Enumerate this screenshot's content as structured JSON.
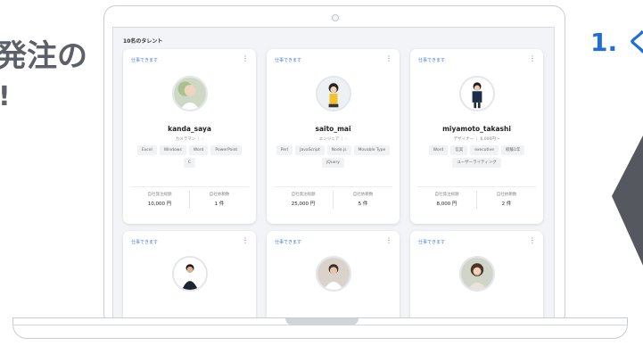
{
  "headline": {
    "line1": "発注の",
    "line2": "!"
  },
  "step_label": "1. く",
  "screen": {
    "header": "10名のタレント",
    "cards": [
      {
        "tag": "仕事できます",
        "name": "kanda_saya",
        "meta": "カメラマン ｜ -",
        "chips": [
          "Excel",
          "Windows",
          "Word",
          "PowerPoint",
          "C"
        ],
        "stat1_label": "自社発注総額",
        "stat1_value": "10,000 円",
        "stat2_label": "自社依頼数",
        "stat2_value": "1 件"
      },
      {
        "tag": "仕事できます",
        "name": "saito_mai",
        "meta": "エンジニア ｜ -",
        "chips": [
          "Perl",
          "JavaScript",
          "Node.js",
          "Movable Type",
          "jQuery"
        ],
        "stat1_label": "自社発注総額",
        "stat1_value": "25,000 円",
        "stat2_label": "自社依頼数",
        "stat2_value": "5 件"
      },
      {
        "tag": "仕事できます",
        "name": "miyamoto_takashi",
        "meta": "デザイナー ｜ 6,000円〜",
        "chips": [
          "Word",
          "信実",
          "executive",
          "経験1年",
          "ユーザーライティング"
        ],
        "stat1_label": "自社発注総額",
        "stat1_value": "8,000 円",
        "stat2_label": "自社依頼数",
        "stat2_value": "2 件"
      },
      {
        "tag": "仕事できます"
      },
      {
        "tag": "仕事できます"
      },
      {
        "tag": "仕事できます"
      }
    ]
  },
  "colors": {
    "accent": "#1f6fd8",
    "tag": "#4a7be0",
    "text_gray": "#5b6069"
  }
}
